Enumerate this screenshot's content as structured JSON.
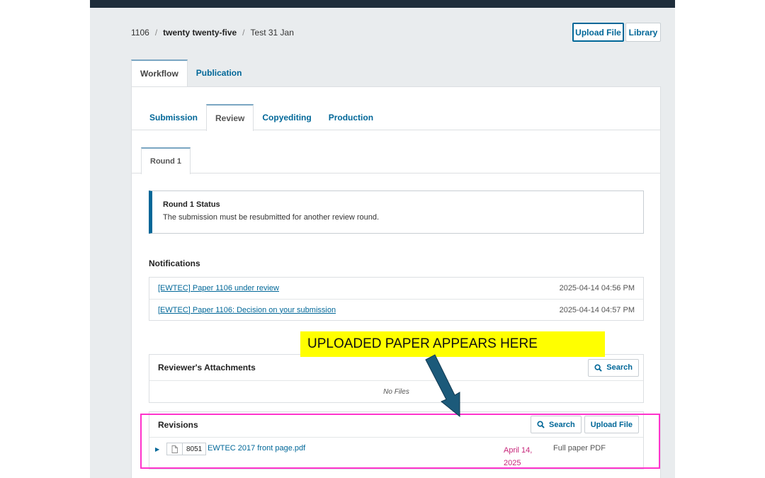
{
  "breadcrumb": {
    "id": "1106",
    "journal": "twenty twenty-five",
    "current": "Test 31 Jan"
  },
  "header_buttons": {
    "upload_file": "Upload File",
    "library": "Library"
  },
  "top_tabs": [
    {
      "label": "Workflow",
      "active": true
    },
    {
      "label": "Publication",
      "active": false
    }
  ],
  "stage_tabs": [
    {
      "label": "Submission",
      "active": false
    },
    {
      "label": "Review",
      "active": true
    },
    {
      "label": "Copyediting",
      "active": false
    },
    {
      "label": "Production",
      "active": false
    }
  ],
  "round_tab": {
    "label": "Round 1"
  },
  "round_status": {
    "title": "Round 1 Status",
    "text": "The submission must be resubmitted for another review round."
  },
  "notifications": {
    "heading": "Notifications",
    "items": [
      {
        "subject": "[EWTEC] Paper 1106 under review",
        "date": "2025-04-14 04:56 PM"
      },
      {
        "subject": "[EWTEC] Paper 1106: Decision on your submission",
        "date": "2025-04-14 04:57 PM"
      }
    ]
  },
  "reviewer_attachments": {
    "heading": "Reviewer's Attachments",
    "search_label": "Search",
    "empty_text": "No Files"
  },
  "revisions": {
    "heading": "Revisions",
    "search_label": "Search",
    "upload_label": "Upload File",
    "files": [
      {
        "id": "8051",
        "name": "EWTEC 2017 front page.pdf",
        "date": "April 14, 2025",
        "type": "Full paper PDF"
      }
    ]
  },
  "annotation": {
    "text": "UPLOADED PAPER APPEARS HERE",
    "highlight_color": "#ffff00",
    "box_color": "#ff33cc",
    "arrow_color": "#1c5a7a"
  },
  "colors": {
    "link": "#006798",
    "topbar": "#1e2d3b",
    "background": "#e9ecee",
    "date_accent": "#c7267a"
  }
}
